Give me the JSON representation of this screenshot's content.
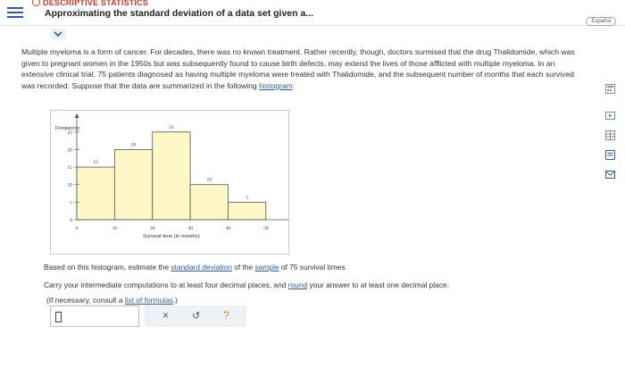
{
  "header": {
    "topic": "DESCRIPTIVE STATISTICS",
    "title": "Approximating the standard deviation of a data set given a...",
    "language_button": "Español"
  },
  "problem": {
    "p1": "Multiple myeloma is a form of cancer. For decades, there was no known treatment. Rather recently, though, doctors surmised that the drug Thalidomide, which was given to pregnant women in the 1950s but was subsequently found to cause birth defects, may extend the lives of those afflicted with multiple myeloma. In an extensive clinical trial, 75 patients diagnosed as having multiple myeloma were treated with Thalidomide, and the subsequent number of months that each survived was recorded. Suppose that the data are summarized in the following ",
    "p1_link": "histogram",
    "p1_end": ":"
  },
  "chart_data": {
    "type": "bar",
    "ylabel": "Frequency",
    "xlabel": "Survival time (in months)",
    "bin_edges": [
      0,
      10,
      20,
      30,
      40,
      50
    ],
    "values": [
      15,
      20,
      25,
      10,
      5
    ],
    "xticks": [
      "0",
      "10",
      "20",
      "30",
      "40",
      "50"
    ],
    "yticks": [
      "0",
      "5",
      "10",
      "15",
      "20",
      "25"
    ],
    "ylim": [
      0,
      28
    ],
    "xlim": [
      0,
      55
    ],
    "bar_color": "#fff8c6",
    "bar_edge_color": "#555555"
  },
  "question": {
    "line1_a": "Based on this histogram, estimate the ",
    "line1_link1": "standard deviation",
    "line1_b": " of the ",
    "line1_link2": "sample",
    "line1_c": " of 75 survival times.",
    "line2_a": "Carry your intermediate computations to at least four decimal places, and ",
    "line2_link": "round",
    "line2_b": " your answer to at least one decimal place.",
    "line3_a": "(If necessary, consult a ",
    "line3_link": "list of formulas",
    "line3_b": ".)"
  },
  "answer": {
    "value": ""
  },
  "actions": {
    "clear": "×",
    "undo": "↺",
    "help": "?"
  }
}
